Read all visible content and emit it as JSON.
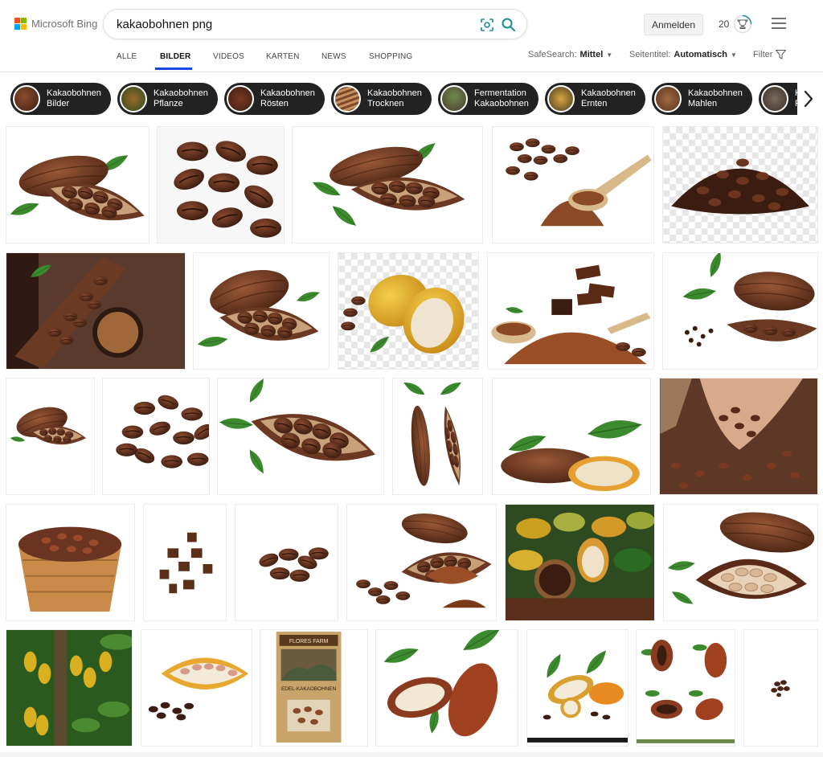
{
  "brand": {
    "name": "Microsoft Bing"
  },
  "search": {
    "query": "kakaobohnen png"
  },
  "header": {
    "signin_label": "Anmelden",
    "rewards_count": "20"
  },
  "nav": {
    "tabs": [
      {
        "label": "ALLE"
      },
      {
        "label": "BILDER"
      },
      {
        "label": "VIDEOS"
      },
      {
        "label": "KARTEN"
      },
      {
        "label": "NEWS"
      },
      {
        "label": "SHOPPING"
      }
    ],
    "active_tab": "BILDER",
    "safesearch_label": "SafeSearch:",
    "safesearch_value": "Mittel",
    "layout_label": "Seitentitel:",
    "layout_value": "Automatisch",
    "filter_label": "Filter"
  },
  "related": [
    {
      "line1": "Kakaobohnen",
      "line2": "Bilder"
    },
    {
      "line1": "Kakaobohnen",
      "line2": "Pflanze"
    },
    {
      "line1": "Kakaobohnen",
      "line2": "Rösten"
    },
    {
      "line1": "Kakaobohnen",
      "line2": "Trocknen"
    },
    {
      "line1": "Fermentation",
      "line2": "Kakaobohnen"
    },
    {
      "line1": "Kakaobohnen",
      "line2": "Ernten"
    },
    {
      "line1": "Kakaobohnen",
      "line2": "Mahlen"
    },
    {
      "line1": "K",
      "line2": "F"
    }
  ],
  "product_box": {
    "brand": "FLORES FARM",
    "title": "EDEL-KAKAOBOHNEN"
  },
  "colors": {
    "accent": "#174ae4",
    "pill_bg": "#222222",
    "pod_brown": "#6b3a22",
    "bean_dark": "#3b2014",
    "leaf_green": "#3c8a2e",
    "yellow_pod": "#e8b52a"
  }
}
